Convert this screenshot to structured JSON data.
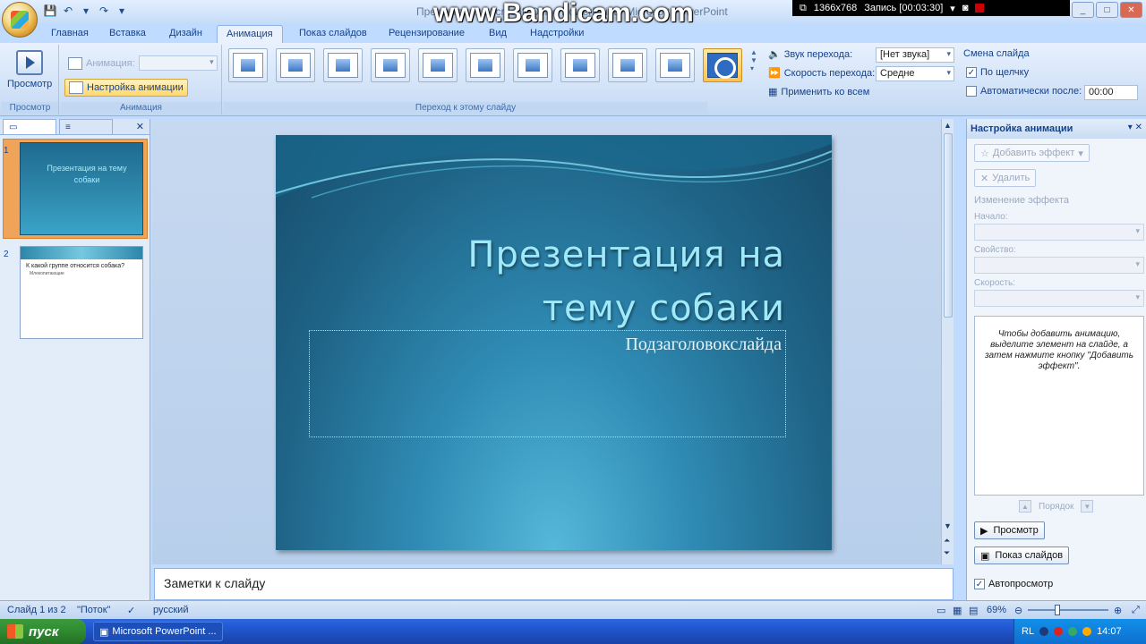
{
  "window": {
    "title": "Презентация Microsoft Office PowerPoint - Microsoft PowerPoint",
    "watermark": "www.Bandicam.com",
    "record_res": "1366x768",
    "record_time": "Запись [00:03:30]"
  },
  "tabs": [
    "Главная",
    "Вставка",
    "Дизайн",
    "Анимация",
    "Показ слайдов",
    "Рецензирование",
    "Вид",
    "Надстройки"
  ],
  "ribbon": {
    "preview_label": "Просмотр",
    "preview_group_label": "Просмотр",
    "animation_label": "Анимация:",
    "custom_animation_label": "Настройка анимации",
    "animation_group_label": "Анимация",
    "transitions_group_label": "Переход к этому слайду",
    "sound_label": "Звук перехода:",
    "sound_value": "[Нет звука]",
    "speed_label": "Скорость перехода:",
    "speed_value": "Средне",
    "apply_all_label": "Применить ко всем",
    "advance_label": "Смена слайда",
    "on_click_label": "По щелчку",
    "auto_after_label": "Автоматически после:",
    "auto_after_value": "00:00"
  },
  "slides_panel": {
    "slide1_title": "Презентация на тему собаки",
    "slide2_title": "К какой группе относится собака?",
    "slide2_body": "Млекопитающие",
    "num1": "1",
    "num2": "2"
  },
  "slide": {
    "title": "Презентация на тему собаки",
    "subtitle": "Подзаголовокслайда"
  },
  "notes_placeholder": "Заметки к слайду",
  "task_pane": {
    "title": "Настройка анимации",
    "add_effect": "Добавить эффект",
    "remove": "Удалить",
    "modify_label": "Изменение эффекта",
    "start_label": "Начало:",
    "property_label": "Свойство:",
    "speed_label": "Скорость:",
    "hint": "Чтобы добавить анимацию, выделите элемент на слайде, а затем нажмите кнопку \"Добавить эффект\".",
    "order_label": "Порядок",
    "play_label": "Просмотр",
    "slideshow_label": "Показ слайдов",
    "autopreview_label": "Автопросмотр"
  },
  "status": {
    "slide_info": "Слайд 1 из 2",
    "theme": "\"Поток\"",
    "language": "русский",
    "zoom": "69%"
  },
  "taskbar": {
    "start": "пуск",
    "app": "Microsoft PowerPoint ...",
    "lang": "RL",
    "time": "14:07"
  },
  "colors": {
    "accent": "#15428b",
    "ribbon_bg": "#d3e3f8",
    "slide_bg": "#2f8bb4",
    "title_text": "#9eeafa"
  }
}
